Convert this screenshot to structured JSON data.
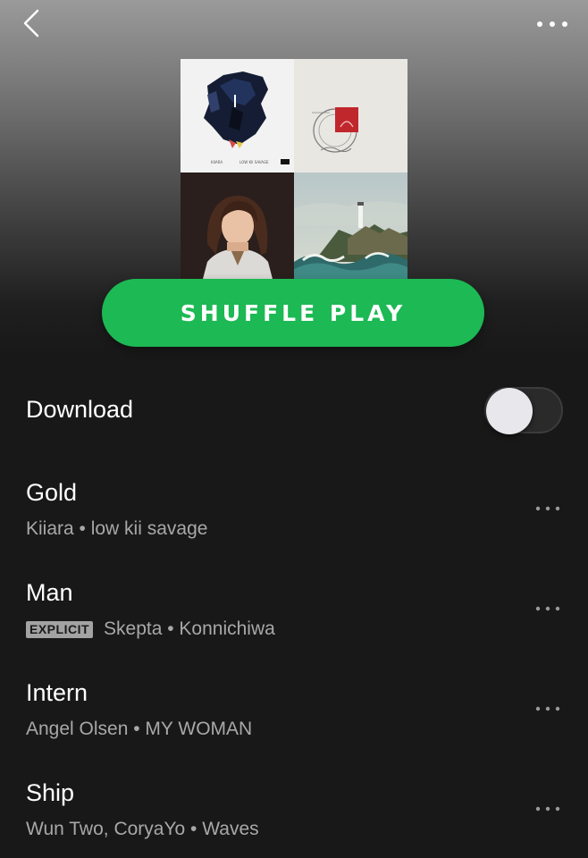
{
  "header": {
    "back_icon": "chevron-left-icon",
    "more_icon": "more-horizontal-icon"
  },
  "cover": {
    "tiles": [
      "album-art-low-kii-savage",
      "album-art-konnichiwa",
      "album-art-my-woman",
      "album-art-waves"
    ],
    "tile1_caption_left": "KIIARA",
    "tile1_caption_right": "LOW KII SAVAGE"
  },
  "shuffle": {
    "label": "SHUFFLE PLAY",
    "color": "#1db954"
  },
  "download": {
    "label": "Download",
    "enabled": false
  },
  "tracks": [
    {
      "title": "Gold",
      "subtitle": "Kiiara • low kii savage",
      "explicit": false
    },
    {
      "title": "Man",
      "subtitle": "Skepta • Konnichiwa",
      "explicit": true,
      "explicit_label": "EXPLICIT"
    },
    {
      "title": "Intern",
      "subtitle": "Angel Olsen • MY WOMAN",
      "explicit": false
    },
    {
      "title": "Ship",
      "subtitle": "Wun Two, CoryaYo • Waves",
      "explicit": false
    }
  ],
  "colors": {
    "background": "#181818",
    "accent": "#1db954",
    "subtext": "#a8a8a8"
  }
}
